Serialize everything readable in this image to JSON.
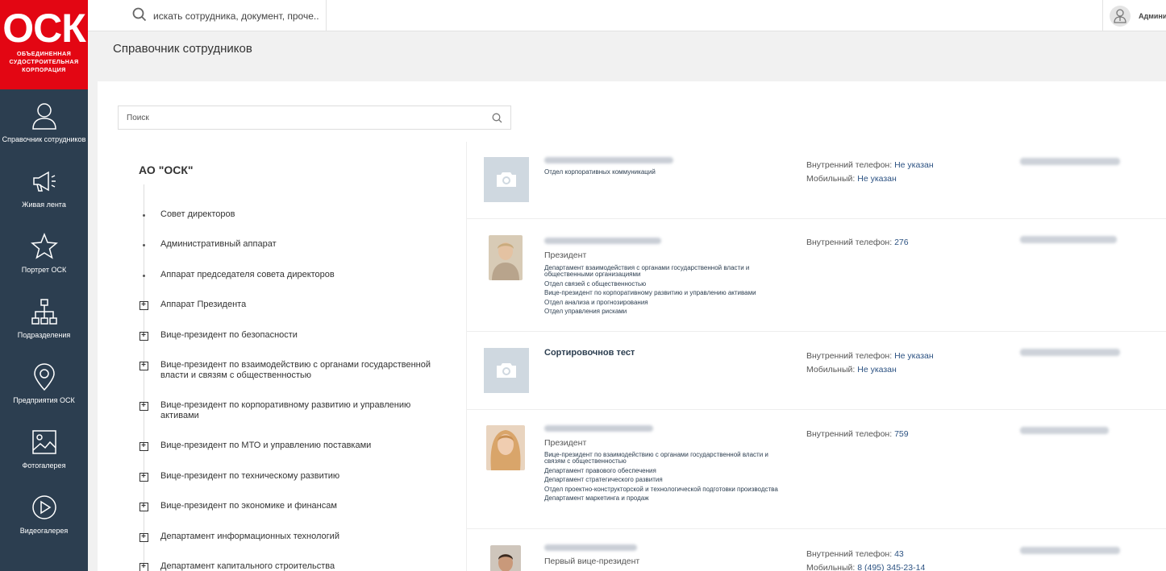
{
  "logo": {
    "mark": "ОСК",
    "line1": "ОБЪЕДИНЕННАЯ",
    "line2": "СУДОСТРОИТЕЛЬНАЯ",
    "line3": "КОРПОРАЦИЯ"
  },
  "sidebar": {
    "items": [
      {
        "icon": "person-icon",
        "label": "Справочник сотрудников"
      },
      {
        "icon": "megaphone-icon",
        "label": "Живая лента"
      },
      {
        "icon": "star-icon",
        "label": "Портрет ОСК"
      },
      {
        "icon": "org-chart-icon",
        "label": "Подразделения"
      },
      {
        "icon": "map-pin-icon",
        "label": "Предприятия ОСК"
      },
      {
        "icon": "image-icon",
        "label": "Фотогалерея"
      },
      {
        "icon": "play-icon",
        "label": "Видеогалерея"
      }
    ]
  },
  "topbar": {
    "search_placeholder": "искать сотрудника, документ, проче...",
    "user_name": "Администратор"
  },
  "page": {
    "title": "Справочник сотрудников"
  },
  "search": {
    "placeholder": "Поиск"
  },
  "tree": {
    "root": "АО \"ОСК\"",
    "items": [
      {
        "label": "Совет директоров",
        "expandable": false
      },
      {
        "label": "Административный аппарат",
        "expandable": false
      },
      {
        "label": "Аппарат председателя совета директоров",
        "expandable": false
      },
      {
        "label": "Аппарат Президента",
        "expandable": true
      },
      {
        "label": "Вице-президент по безопасности",
        "expandable": true
      },
      {
        "label": "Вице-президент по взаимодействию с органами государственной власти и связям с общественностью",
        "expandable": true
      },
      {
        "label": "Вице-президент по корпоративному развитию и управлению активами",
        "expandable": true
      },
      {
        "label": "Вице-президент по МТО и управлению поставками",
        "expandable": true
      },
      {
        "label": "Вице-президент по техническому развитию",
        "expandable": true
      },
      {
        "label": "Вице-президент по экономике и финансам",
        "expandable": true
      },
      {
        "label": "Департамент информационных технологий",
        "expandable": true
      },
      {
        "label": "Департамент капитального строительства",
        "expandable": true
      }
    ]
  },
  "employees": [
    {
      "name": "",
      "position": "",
      "departments": [
        "Отдел корпоративных коммуникаций"
      ],
      "phone_label": "Внутренний телефон:",
      "phone": "Не указан",
      "mobile_label": "Мобильный:",
      "mobile": "Не указан"
    },
    {
      "name": "",
      "position": "Президент",
      "departments": [
        "Департамент взаимодействия с органами государственной власти и общественными организациями",
        "Отдел связей с общественностью",
        "Вице-президент по корпоративному развитию и управлению активами",
        "Отдел анализа и прогнозирования",
        "Отдел управления рисками"
      ],
      "phone_label": "Внутренний телефон:",
      "phone": "276"
    },
    {
      "name": "Сортировочнов тест",
      "position": "",
      "departments": [],
      "phone_label": "Внутренний телефон:",
      "phone": "Не указан",
      "mobile_label": "Мобильный:",
      "mobile": "Не указан"
    },
    {
      "name": "",
      "position": "Президент",
      "departments": [
        "Вице-президент по взаимодействию с органами государственной власти и связям с общественностью",
        "Департамент правового обеспечения",
        "Департамент стратегического развития",
        "Отдел проектно-конструкторской и технологической подготовки производства",
        "Департамент маркетинга и продаж"
      ],
      "phone_label": "Внутренний телефон:",
      "phone": "759"
    },
    {
      "name": "",
      "position": "Первый вице-президент",
      "departments": [],
      "phone_label": "Внутренний телефон:",
      "phone": "43",
      "mobile_label": "Мобильный:",
      "mobile": "8 (495) 345-23-14"
    }
  ]
}
